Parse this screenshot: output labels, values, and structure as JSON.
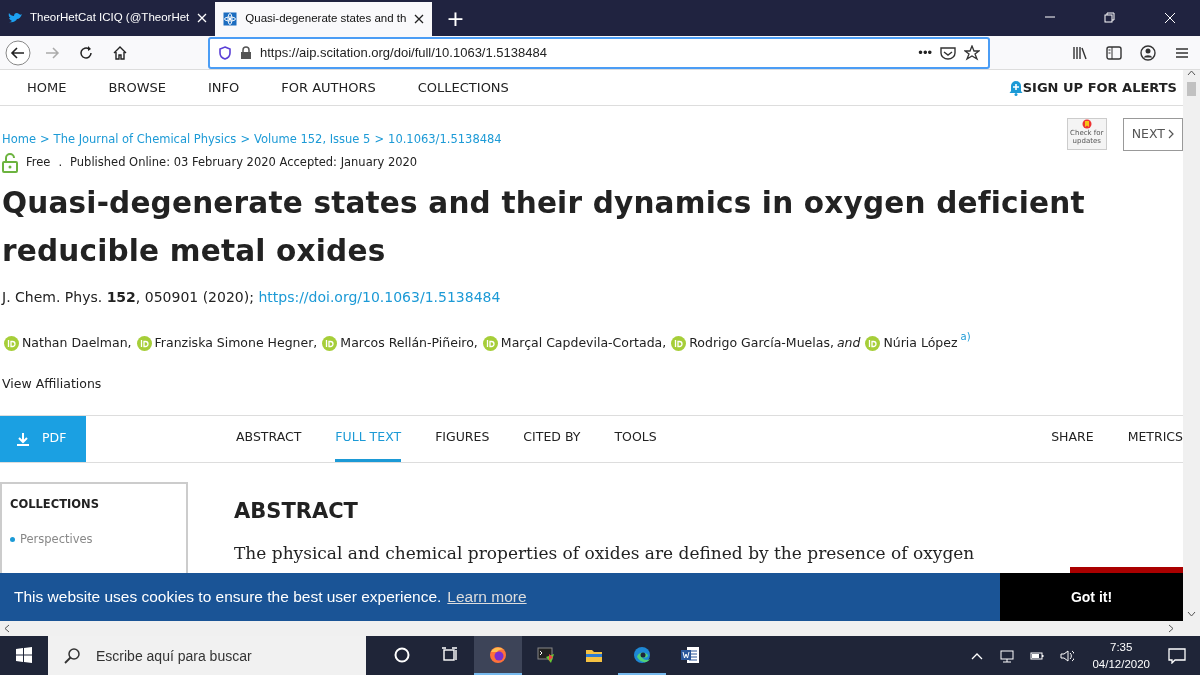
{
  "browser": {
    "tabs": [
      {
        "label": "TheorHetCat ICIQ (@TheorHet",
        "selected": false
      },
      {
        "label": "Quasi-degenerate states and th",
        "selected": true
      }
    ],
    "new_tab": "+",
    "forward_disabled": true,
    "url": "https://aip.scitation.org/doi/full/10.1063/1.5138484",
    "url_actions": "•••"
  },
  "site_nav": {
    "items": [
      "HOME",
      "BROWSE",
      "INFO",
      "FOR AUTHORS",
      "COLLECTIONS"
    ],
    "alerts": "SIGN UP FOR ALERTS"
  },
  "breadcrumb": [
    "Home",
    "The Journal of Chemical Physics",
    "Volume 152, Issue 5",
    "10.1063/1.5138484"
  ],
  "breadcrumb_separator": ">",
  "check_updates": "Check for updates",
  "next_button": "NEXT",
  "access": {
    "label": "Free",
    "separator": ".",
    "published": "Published Online: 03 February 2020 Accepted: January 2020"
  },
  "title": "Quasi-degenerate states and their dynamics in oxygen deficient reducible metal oxides",
  "citation": {
    "text": "J. Chem. Phys. **152**, 050901 (2020);",
    "doi": "https://doi.org/10.1063/1.5138484"
  },
  "authors": [
    {
      "name": "Nathan Daelman,"
    },
    {
      "name": "Franziska Simone Hegner,"
    },
    {
      "name": "Marcos Rellán-Piñeiro,"
    },
    {
      "name": "Marçal Capdevila-Cortada,"
    },
    {
      "name": "Rodrigo García-Muelas,"
    },
    {
      "name": "Núria López",
      "conjunction": "and",
      "footnote": "a)"
    }
  ],
  "view_affiliations": "View Affiliations",
  "pdf_button": "PDF",
  "article_tabs": [
    {
      "label": "ABSTRACT",
      "selected": false
    },
    {
      "label": "FULL TEXT",
      "selected": true
    },
    {
      "label": "FIGURES",
      "selected": false
    },
    {
      "label": "CITED BY",
      "selected": false
    },
    {
      "label": "TOOLS",
      "selected": false
    }
  ],
  "share": "SHARE",
  "metrics": "METRICS",
  "sidebar": {
    "heading": "COLLECTIONS",
    "items": [
      "Perspectives"
    ]
  },
  "abstract": {
    "heading": "ABSTRACT",
    "text": "The physical and chemical properties of oxides are defined by the presence of oxygen"
  },
  "cookie_bar": {
    "message": "This website uses cookies to ensure the best user experience.",
    "link": "Learn more",
    "button": "Got it!"
  },
  "taskbar": {
    "search_placeholder": "Escribe aquí para buscar",
    "apps": [
      {
        "kind": "cortana",
        "running": false,
        "selected": false
      },
      {
        "kind": "taskview",
        "running": false,
        "selected": false
      },
      {
        "kind": "firefox",
        "running": true,
        "selected": true
      },
      {
        "kind": "terminal",
        "running": false,
        "selected": false
      },
      {
        "kind": "folder",
        "running": false,
        "selected": false
      },
      {
        "kind": "edge",
        "running": true,
        "selected": false
      },
      {
        "kind": "word",
        "running": false,
        "selected": false
      }
    ],
    "time": "7:35",
    "date": "04/12/2020"
  }
}
